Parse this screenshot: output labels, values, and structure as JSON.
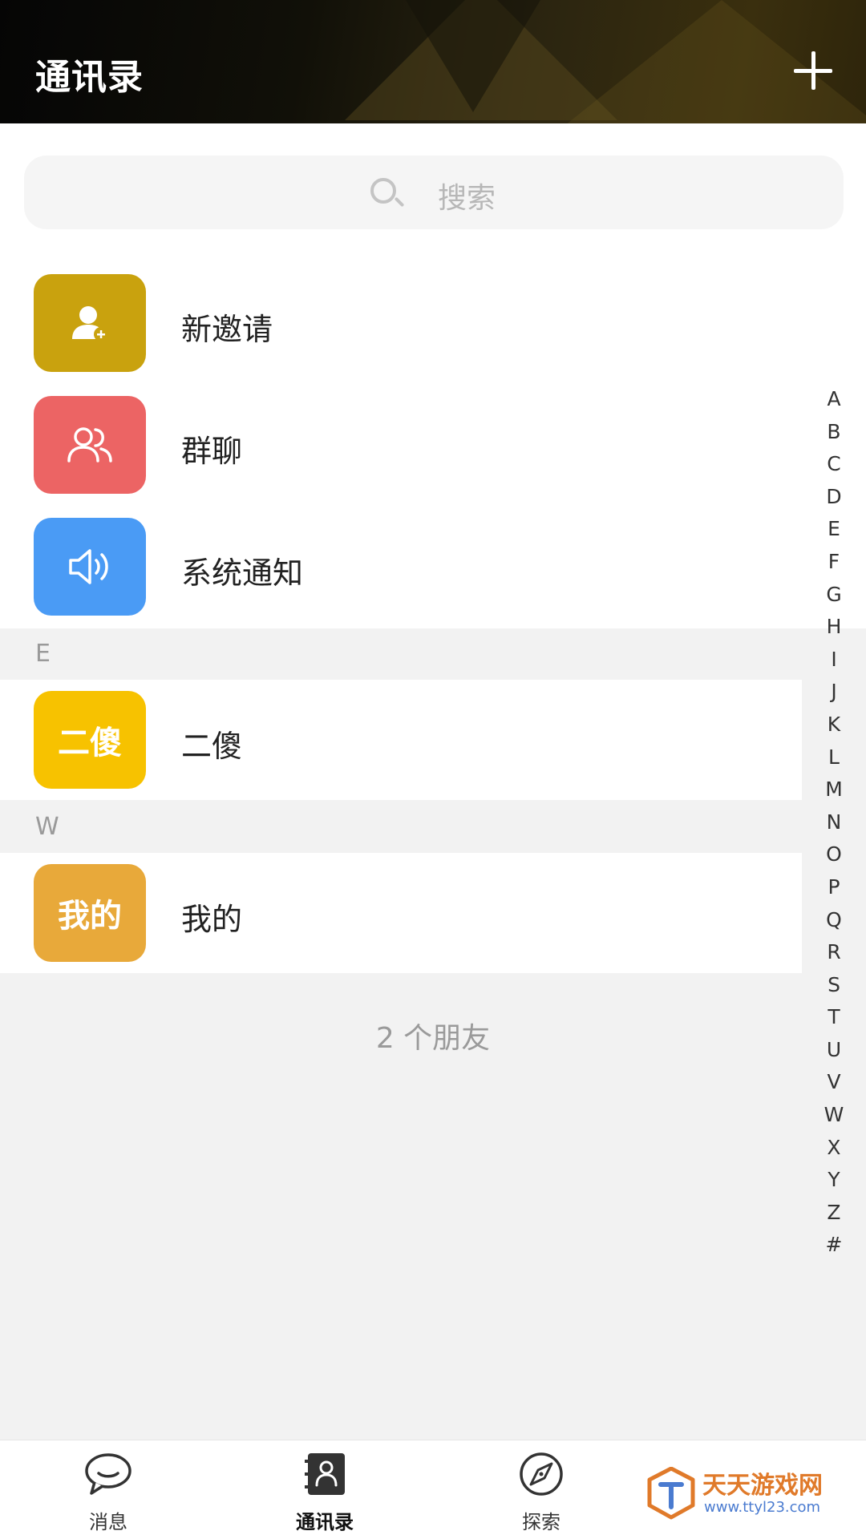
{
  "header": {
    "title": "通讯录"
  },
  "search": {
    "placeholder": "搜索"
  },
  "top_items": [
    {
      "label": "新邀请",
      "color": "#c9a20e",
      "icon": "add-user-icon"
    },
    {
      "label": "群聊",
      "color": "#ec6464",
      "icon": "group-icon"
    },
    {
      "label": "系统通知",
      "color": "#4a9bf5",
      "icon": "speaker-icon"
    }
  ],
  "sections": [
    {
      "letter": "E",
      "contacts": [
        {
          "name": "二傻",
          "avatar_text": "二傻",
          "color": "#f7c200"
        }
      ]
    },
    {
      "letter": "W",
      "contacts": [
        {
          "name": "我的",
          "avatar_text": "我的",
          "color": "#e8a93a"
        }
      ]
    }
  ],
  "friend_count": "2 个朋友",
  "alphabet": [
    "A",
    "B",
    "C",
    "D",
    "E",
    "F",
    "G",
    "H",
    "I",
    "J",
    "K",
    "L",
    "M",
    "N",
    "O",
    "P",
    "Q",
    "R",
    "S",
    "T",
    "U",
    "V",
    "W",
    "X",
    "Y",
    "Z",
    "#"
  ],
  "nav": [
    {
      "label": "消息",
      "icon": "chat-bubble-icon",
      "active": false
    },
    {
      "label": "通讯录",
      "icon": "contacts-icon",
      "active": true
    },
    {
      "label": "探索",
      "icon": "compass-icon",
      "active": false
    }
  ],
  "watermark": {
    "text": "天天游戏网",
    "url": "www.ttyl23.com"
  }
}
